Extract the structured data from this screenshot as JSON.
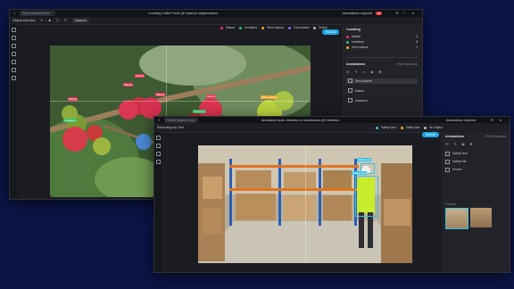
{
  "w1": {
    "search_placeholder": "Select dataset here",
    "title": "Counting Coffee Fruits @ Instance segmentation",
    "annotations_label": "Annotations required",
    "annotations_badge": "99",
    "toolbar_tool": "Object selection",
    "toolbar_mode": "Instance",
    "legend": [
      "Mature",
      "Immature",
      "Semi-mature",
      "Overmature",
      "Empty"
    ],
    "legend_colors": [
      "#e8375b",
      "#3ac46b",
      "#f5a524",
      "#8d6bf1",
      "#b8b8b8"
    ],
    "submit": "Submit",
    "counting_title": "Counting",
    "counts": [
      {
        "label": "Mature",
        "value": "4",
        "color": "#e8375b"
      },
      {
        "label": "Immature",
        "value": "8",
        "color": "#3ac46b"
      },
      {
        "label": "Semi-mature",
        "value": "1",
        "color": "#f5a524"
      }
    ],
    "annotations_title": "Annotations",
    "annotations_filter": "Filter by name",
    "annotation_rows": [
      "Semi-mature",
      "Mature",
      "Immature"
    ],
    "fruit_labels": [
      {
        "text": "Mature",
        "color": "#e8375b"
      },
      {
        "text": "Mature",
        "color": "#e8375b"
      },
      {
        "text": "Mature",
        "color": "#e8375b"
      },
      {
        "text": "Mature",
        "color": "#e8375b"
      },
      {
        "text": "Mature",
        "color": "#e8375b"
      },
      {
        "text": "Immature",
        "color": "#3ac46b"
      },
      {
        "text": "Immature",
        "color": "#3ac46b"
      },
      {
        "text": "Semi-mature",
        "color": "#f5a524"
      },
      {
        "text": "Immature",
        "color": "#3ac46b"
      }
    ]
  },
  "w2": {
    "search_placeholder": "Select dataset here",
    "title": "Annotation tools: detection in warehouses @ Detection",
    "annotations_label": "Annotations required",
    "nav_label": "Recording the Text",
    "tabs": [
      "Safety Vest",
      "Safety Hat",
      "No Object"
    ],
    "submit": "Submit",
    "panel_title": "Annotations",
    "panel_filter": "Filter by name",
    "rows": [
      "Safety Vest",
      "Safety Hat",
      "Person"
    ],
    "thumbs_label": "Frames",
    "box_labels": [
      {
        "text": "Safety Hat",
        "color": "#35c2e6"
      },
      {
        "text": "Safety Vest",
        "color": "#35c2e6"
      }
    ]
  }
}
